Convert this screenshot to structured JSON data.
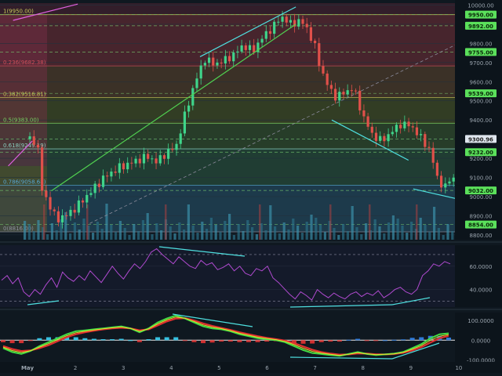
{
  "chart_data": [
    {
      "panel": "price",
      "type": "candlestick",
      "y_axis_ticks": [
        "10000.00",
        "9900.00",
        "9800.00",
        "9700.00",
        "9600.00",
        "9500.00",
        "9400.00",
        "9300.00",
        "9200.00",
        "9100.00",
        "9000.00",
        "8900.00",
        "8800.00"
      ],
      "ylim": [
        8775,
        10010
      ],
      "x_axis_ticks": [
        "May",
        "2",
        "3",
        "4",
        "5",
        "6",
        "7",
        "8",
        "9",
        "10"
      ],
      "price_tags": [
        {
          "label": "9950.00",
          "value": 9950
        },
        {
          "label": "9892.00",
          "value": 9892
        },
        {
          "label": "9755.00",
          "value": 9755
        },
        {
          "label": "9539.00",
          "value": 9539
        },
        {
          "label": "9300.96",
          "value": 9300.96,
          "current": true
        },
        {
          "label": "9232.00",
          "value": 9232
        },
        {
          "label": "9032.00",
          "value": 9032
        },
        {
          "label": "8854.00",
          "value": 8854
        }
      ],
      "fib_levels": [
        {
          "label": "1(9950.00)",
          "value": 9950
        },
        {
          "label": "0.236(9682.38)",
          "value": 9682.38
        },
        {
          "label": "0.382(9516.81)",
          "value": 9516.81
        },
        {
          "label": "0.5(9383.00)",
          "value": 9383
        },
        {
          "label": "0.618(9249.19)",
          "value": 9249.19
        },
        {
          "label": "0.786(9058.68)",
          "value": 9058.68
        },
        {
          "label": "0(8816.00)",
          "value": 8816
        }
      ],
      "close_path": [
        [
          0.0,
          9300
        ],
        [
          0.2,
          9290
        ],
        [
          0.3,
          9040
        ],
        [
          0.45,
          8960
        ],
        [
          0.6,
          8880
        ],
        [
          0.8,
          8900
        ],
        [
          1.0,
          8940
        ],
        [
          1.3,
          9020
        ],
        [
          1.6,
          9100
        ],
        [
          1.9,
          9150
        ],
        [
          2.2,
          9180
        ],
        [
          2.5,
          9210
        ],
        [
          2.7,
          9180
        ],
        [
          2.9,
          9230
        ],
        [
          3.1,
          9260
        ],
        [
          3.3,
          9440
        ],
        [
          3.5,
          9600
        ],
        [
          3.7,
          9720
        ],
        [
          3.9,
          9690
        ],
        [
          4.1,
          9710
        ],
        [
          4.3,
          9740
        ],
        [
          4.5,
          9790
        ],
        [
          4.7,
          9760
        ],
        [
          4.9,
          9830
        ],
        [
          5.1,
          9880
        ],
        [
          5.3,
          9940
        ],
        [
          5.5,
          9900
        ],
        [
          5.7,
          9920
        ],
        [
          5.85,
          9870
        ],
        [
          6.0,
          9780
        ],
        [
          6.1,
          9680
        ],
        [
          6.25,
          9590
        ],
        [
          6.4,
          9520
        ],
        [
          6.6,
          9540
        ],
        [
          6.8,
          9570
        ],
        [
          7.0,
          9420
        ],
        [
          7.2,
          9320
        ],
        [
          7.4,
          9290
        ],
        [
          7.6,
          9340
        ],
        [
          7.8,
          9380
        ],
        [
          8.0,
          9370
        ],
        [
          8.2,
          9310
        ],
        [
          8.4,
          9240
        ],
        [
          8.55,
          9100
        ],
        [
          8.7,
          9040
        ],
        [
          8.85,
          9110
        ],
        [
          9.0,
          9060
        ],
        [
          9.15,
          8980
        ],
        [
          9.3,
          9010
        ],
        [
          9.45,
          9150
        ],
        [
          9.6,
          9270
        ],
        [
          9.75,
          9300
        ]
      ],
      "trendlines": [
        {
          "name": "upper-left",
          "points": [
            [
              -0.3,
              9920
            ],
            [
              1.05,
              10005
            ]
          ]
        },
        {
          "name": "rising-top",
          "points": [
            [
              3.6,
              9730
            ],
            [
              5.6,
              9990
            ]
          ]
        },
        {
          "name": "rising-bottom-green",
          "points": [
            [
              0.5,
              9030
            ],
            [
              5.6,
              9900
            ]
          ]
        },
        {
          "name": "channel-dashed",
          "points": [
            [
              1.3,
              8860
            ],
            [
              10.1,
              9935
            ]
          ]
        },
        {
          "name": "fall-upper",
          "points": [
            [
              6.35,
              9400
            ],
            [
              7.95,
              9190
            ]
          ]
        },
        {
          "name": "fall-lower",
          "points": [
            [
              8.05,
              9040
            ],
            [
              9.2,
              8975
            ]
          ]
        },
        {
          "name": "left-pink",
          "points": [
            [
              -0.4,
              9160
            ],
            [
              0.1,
              9290
            ]
          ]
        }
      ]
    },
    {
      "panel": "rsi",
      "type": "line",
      "y_axis_ticks": [
        "60.0000",
        "40.0000"
      ],
      "ylim": [
        25,
        78
      ],
      "levels": [
        70,
        30
      ],
      "values": [
        48,
        52,
        45,
        50,
        38,
        34,
        40,
        36,
        44,
        50,
        42,
        55,
        50,
        47,
        52,
        48,
        56,
        51,
        46,
        53,
        60,
        54,
        49,
        56,
        62,
        58,
        64,
        72,
        75,
        70,
        66,
        62,
        68,
        64,
        60,
        58,
        65,
        61,
        63,
        57,
        59,
        62,
        56,
        60,
        54,
        52,
        58,
        56,
        60,
        50,
        46,
        41,
        36,
        32,
        38,
        35,
        31,
        40,
        36,
        33,
        37,
        34,
        32,
        36,
        38,
        34,
        37,
        35,
        39,
        33,
        36,
        40,
        42,
        38,
        36,
        40,
        52,
        56,
        62,
        60,
        64,
        62
      ]
    },
    {
      "panel": "macd",
      "type": "histogram+line",
      "y_axis_ticks": [
        "100.0000",
        "0.0000",
        "-100.0000"
      ],
      "ylim": [
        -110,
        140
      ],
      "macd": [
        -40,
        -60,
        -70,
        -55,
        -30,
        -10,
        10,
        30,
        45,
        50,
        55,
        60,
        65,
        70,
        60,
        40,
        60,
        90,
        110,
        125,
        110,
        90,
        70,
        60,
        55,
        45,
        30,
        20,
        10,
        5,
        0,
        -10,
        -30,
        -50,
        -65,
        -70,
        -75,
        -80,
        -70,
        -60,
        -70,
        -75,
        -72,
        -68,
        -60,
        -40,
        -20,
        10,
        30,
        35
      ],
      "signal": [
        -30,
        -45,
        -55,
        -52,
        -40,
        -25,
        -5,
        15,
        30,
        40,
        48,
        55,
        60,
        63,
        60,
        50,
        55,
        75,
        95,
        110,
        112,
        100,
        85,
        72,
        62,
        52,
        40,
        30,
        20,
        12,
        5,
        -2,
        -15,
        -32,
        -48,
        -60,
        -68,
        -73,
        -72,
        -67,
        -68,
        -72,
        -72,
        -70,
        -64,
        -52,
        -35,
        -12,
        10,
        22
      ],
      "histogram": [
        -10,
        -15,
        -15,
        -3,
        10,
        15,
        15,
        15,
        15,
        10,
        7,
        5,
        5,
        7,
        0,
        -10,
        5,
        15,
        15,
        15,
        -2,
        -10,
        -15,
        -12,
        -7,
        -7,
        -10,
        -10,
        -10,
        -7,
        -5,
        -8,
        -15,
        -18,
        -17,
        -10,
        -7,
        -7,
        2,
        7,
        -2,
        -3,
        0,
        2,
        4,
        12,
        15,
        22,
        20,
        13
      ]
    }
  ]
}
